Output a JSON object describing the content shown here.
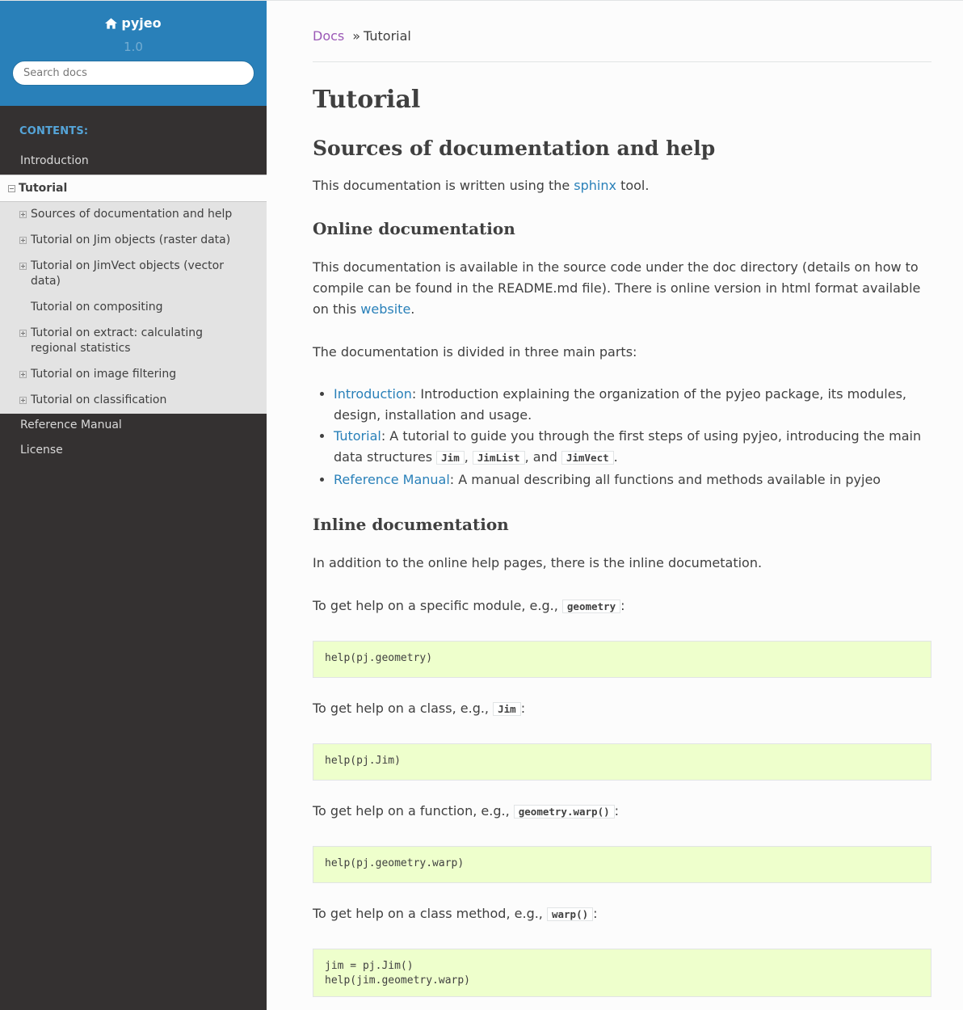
{
  "sidebar": {
    "project": "pyjeo",
    "version": "1.0",
    "search_placeholder": "Search docs",
    "caption": "CONTENTS:",
    "items_before": [
      {
        "label": "Introduction"
      }
    ],
    "current": "Tutorial",
    "subitems": [
      {
        "label": "Sources of documentation and help",
        "expandable": true
      },
      {
        "label": "Tutorial on Jim objects (raster data)",
        "expandable": true
      },
      {
        "label": "Tutorial on JimVect objects (vector data)",
        "expandable": true
      },
      {
        "label": "Tutorial on compositing",
        "expandable": false
      },
      {
        "label": "Tutorial on extract: calculating regional statistics",
        "expandable": true
      },
      {
        "label": "Tutorial on image filtering",
        "expandable": true
      },
      {
        "label": "Tutorial on classification",
        "expandable": true
      }
    ],
    "items_after": [
      {
        "label": "Reference Manual"
      },
      {
        "label": "License"
      }
    ]
  },
  "breadcrumb": {
    "docs": "Docs",
    "sep": "»",
    "current": "Tutorial"
  },
  "page": {
    "title": "Tutorial",
    "section_title": "Sources of documentation and help",
    "intro_before": "This documentation is written using the ",
    "intro_link": "sphinx",
    "intro_after": " tool.",
    "online": {
      "title": "Online documentation",
      "p1_before": "This documentation is available in the source code under the doc directory (details on how to compile can be found in the README.md file). There is online version in html format available on this ",
      "p1_link": "website",
      "p1_after": ".",
      "p2": "The documentation is divided in three main parts:",
      "intro_link": "Introduction",
      "intro_text": ": Introduction explaining the organization of the pyjeo package, its modules, design, installation and usage.",
      "tutorial_link": "Tutorial",
      "tutorial_text": ": A tutorial to guide you through the first steps of using pyjeo, introducing the main data structures ",
      "code_jim": "Jim",
      "comma1": ", ",
      "code_jimlist": "JimList",
      "and": ", and ",
      "code_jimvect": "JimVect",
      "period": ".",
      "ref_link": "Reference Manual",
      "ref_text": ": A manual describing all functions and methods available in pyjeo"
    },
    "inline": {
      "title": "Inline documentation",
      "p1": "In addition to the online help pages, there is the inline documetation.",
      "module_text": "To get help on a specific module, e.g., ",
      "module_code": "geometry",
      "module_block": "help(pj.geometry)",
      "class_text": "To get help on a class, e.g., ",
      "class_code": "Jim",
      "class_block": "help(pj.Jim)",
      "function_text": "To get help on a function, e.g., ",
      "function_code": "geometry.warp()",
      "function_block": "help(pj.geometry.warp)",
      "method_text": "To get help on a class method, e.g., ",
      "method_code": "warp()",
      "method_block": "jim = pj.Jim()\nhelp(jim.geometry.warp)",
      "colon": ":"
    }
  }
}
